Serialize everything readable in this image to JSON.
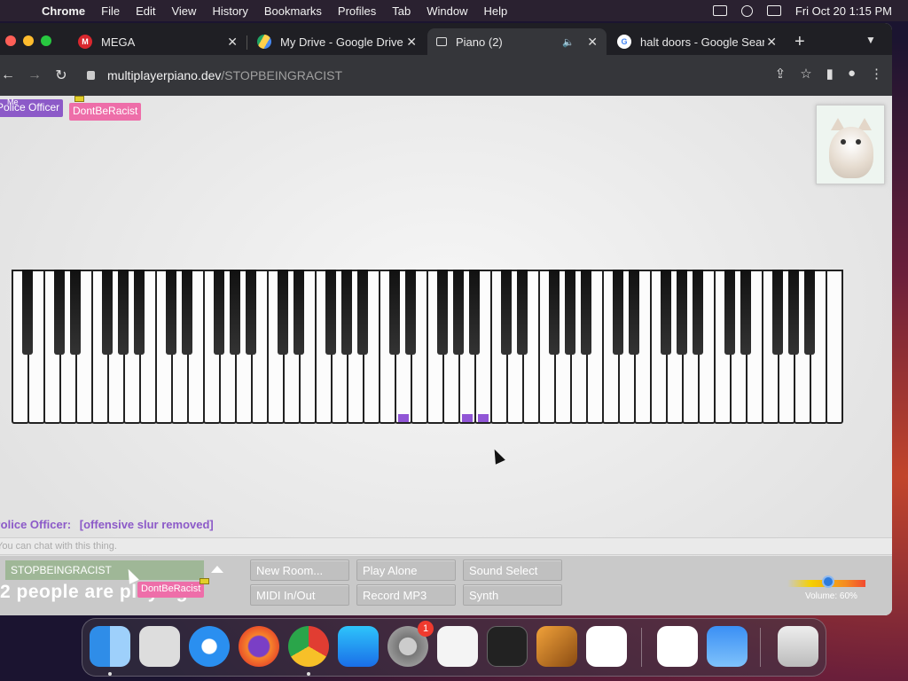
{
  "menubar": {
    "app": "Chrome",
    "items": [
      "File",
      "Edit",
      "View",
      "History",
      "Bookmarks",
      "Profiles",
      "Tab",
      "Window",
      "Help"
    ],
    "clock": "Fri Oct 20  1:15 PM"
  },
  "tabs": [
    {
      "title": "MEGA",
      "icon": "mega-icon",
      "color": "#d9272e"
    },
    {
      "title": "My Drive - Google Drive",
      "icon": "google-drive-icon",
      "color": "#1fa463"
    },
    {
      "title": "Piano (2)",
      "icon": "piano-icon",
      "color": "#ffffff"
    },
    {
      "title": "halt doors - Google Search",
      "icon": "google-icon",
      "color": "#4285f4"
    }
  ],
  "address": {
    "host": "multiplayerpiano.dev",
    "path": "/STOPBEINGRACIST"
  },
  "page": {
    "users": [
      {
        "label": "Police Officer",
        "color": "#8c5ac8",
        "tag": "Me"
      },
      {
        "label": "DontBeRacist",
        "color": "#ee6ea9"
      }
    ],
    "chat": {
      "author": "Police Officer:",
      "message": "[offensive slur removed]",
      "placeholder": "You can chat with this thing."
    },
    "room_name": "STOPBEINGRACIST",
    "player_count_text": "2 people are playing",
    "buttons": {
      "new_room": "New Room...",
      "play_alone": "Play Alone",
      "sound_select": "Sound Select",
      "midi": "MIDI In/Out",
      "record": "Record MP3",
      "synth": "Synth"
    },
    "volume_label": "Volume: 60%",
    "volume_value": 0.6,
    "highlight_color": "#9156d6"
  },
  "dock": [
    "Finder",
    "Launchpad",
    "Safari",
    "Firefox",
    "Chrome",
    "App Store",
    "System Settings",
    "TextEdit",
    "Terminal",
    "GarageBand",
    "Visual Studio Code",
    "Visual Studio",
    "Weather",
    "Trash"
  ],
  "dock_badge": "1"
}
